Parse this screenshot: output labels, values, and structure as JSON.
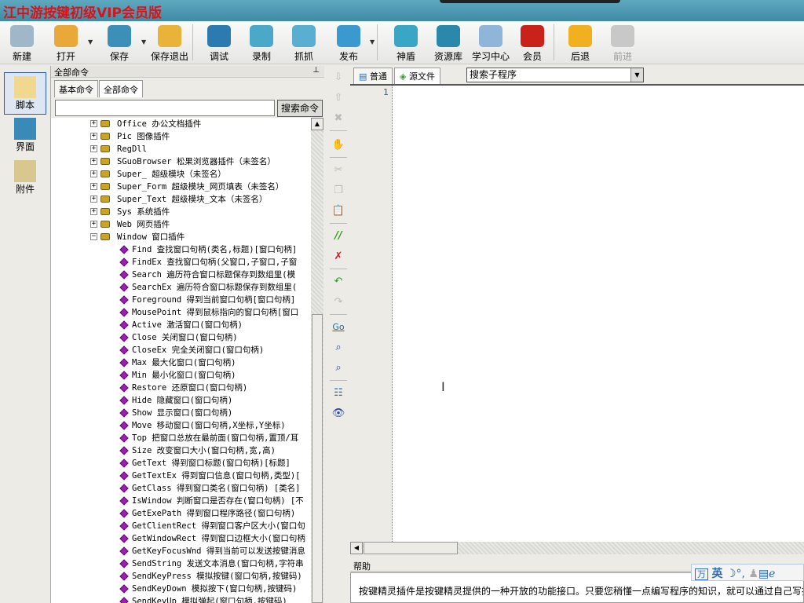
{
  "window": {
    "title": "江中游按键初级VIP会员版"
  },
  "toolbar": {
    "items": [
      {
        "label": "新建",
        "icon": "new-file-icon",
        "color": "#9fb7c8"
      },
      {
        "label": "打开",
        "icon": "open-folder-icon",
        "color": "#e9a83a"
      },
      {
        "label": "保存",
        "icon": "save-icon",
        "color": "#3b8fb8"
      },
      {
        "label": "保存退出",
        "icon": "save-exit-icon",
        "color": "#e9b33a"
      },
      {
        "label": "调试",
        "icon": "debug-icon",
        "color": "#2b7bb0"
      },
      {
        "label": "录制",
        "icon": "record-icon",
        "color": "#4aa8c8"
      },
      {
        "label": "抓抓",
        "icon": "grab-icon",
        "color": "#5aaed0"
      },
      {
        "label": "发布",
        "icon": "publish-icon",
        "color": "#3a9ad0"
      },
      {
        "label": "神盾",
        "icon": "shield-icon",
        "color": "#3aa6c6"
      },
      {
        "label": "资源库",
        "icon": "resource-icon",
        "color": "#2a88aa"
      },
      {
        "label": "学习中心",
        "icon": "learning-center-icon",
        "color": "#8fb6d8"
      },
      {
        "label": "会员",
        "icon": "member-icon",
        "color": "#c8221a"
      },
      {
        "label": "后退",
        "icon": "back-arrow-icon",
        "color": "#f0b020"
      },
      {
        "label": "前进",
        "icon": "forward-arrow-icon",
        "color": "#c8c8c8"
      }
    ]
  },
  "leftbar": {
    "items": [
      {
        "label": "脚本",
        "icon": "script-icon"
      },
      {
        "label": "界面",
        "icon": "ui-icon"
      },
      {
        "label": "附件",
        "icon": "attachment-icon"
      }
    ]
  },
  "panel": {
    "title": "全部命令",
    "tabs": [
      "基本命令",
      "全部命令"
    ],
    "search_value": "",
    "search_button": "搜索命令",
    "plugins": [
      "Office 办公文档插件",
      "Pic 图像插件",
      "RegDll",
      "SGuoBrowser 松果浏览器插件（未签名）",
      "Super_ 超级模块（未签名）",
      "Super_Form 超级模块_网页填表（未签名）",
      "Super_Text 超级模块_文本（未签名）",
      "Sys 系统插件",
      "Web 网页插件",
      "Window 窗口插件"
    ],
    "window_commands": [
      "Find 查找窗口句柄(类名,标题)[窗口句柄]",
      "FindEx 查找窗口句柄(父窗口,子窗口,子窗",
      "Search 遍历符合窗口标题保存到数组里(模",
      "SearchEx 遍历符合窗口标题保存到数组里(",
      "Foreground 得到当前窗口句柄[窗口句柄]",
      "MousePoint 得到鼠标指向的窗口句柄[窗口",
      "Active 激活窗口(窗口句柄)",
      "Close 关闭窗口(窗口句柄)",
      "CloseEx 完全关闭窗口(窗口句柄)",
      "Max 最大化窗口(窗口句柄)",
      "Min 最小化窗口(窗口句柄)",
      "Restore 还原窗口(窗口句柄)",
      "Hide 隐藏窗口(窗口句柄)",
      "Show 显示窗口(窗口句柄)",
      "Move 移动窗口(窗口句柄,X坐标,Y坐标)",
      "Top 把窗口总放在最前面(窗口句柄,置顶/耳",
      "Size 改变窗口大小(窗口句柄,宽,高)",
      "GetText 得到窗口标题(窗口句柄)[标题]",
      "GetTextEx 得到窗口信息(窗口句柄,类型)[",
      "GetClass 得到窗口类名(窗口句柄) [类名]",
      "IsWindow 判断窗口是否存在(窗口句柄) [不",
      "GetExePath 得到窗口程序路径(窗口句柄)",
      "GetClientRect 得到窗口客户区大小(窗口句",
      "GetWindowRect 得到窗口边框大小(窗口句柄",
      "GetKeyFocusWnd 得到当前可以发送按键消息",
      "SendString 发送文本消息(窗口句柄,字符串",
      "SendKeyPress 模拟按键(窗口句柄,按键码)",
      "SendKeyDown 模拟按下(窗口句柄,按键码)",
      "SendKeyUp 模拟弹起(窗口句柄,按键码)"
    ]
  },
  "editor": {
    "tabs": [
      "普通",
      "源文件"
    ],
    "sub_select": "搜索子程序",
    "line_numbers": [
      "1"
    ]
  },
  "help": {
    "title": "帮助",
    "text": "按键精灵插件是按键精灵提供的一种开放的功能接口。只要您稍懂一点编写程序的知识，就可以通过自己写插件扩充插件的功能，也欢迎您把自己写的插件提交给我们，和大家共同分享你的智慧！"
  },
  "ime": {
    "label": "英",
    "icons": [
      "ime-logo-icon",
      "moon-icon",
      "punctuation-icon",
      "user-icon",
      "keyboard-icon",
      "ie-icon"
    ]
  }
}
